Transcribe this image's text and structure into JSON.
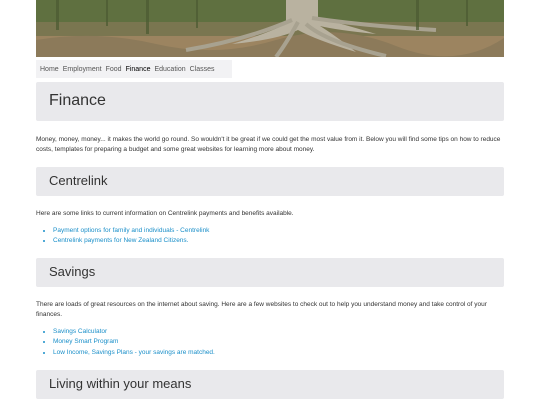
{
  "nav": {
    "items": [
      "Home",
      "Employment",
      "Food",
      "Finance",
      "Education",
      "Classes"
    ],
    "active": "Finance"
  },
  "finance": {
    "title": "Finance",
    "intro": "Money, money, money... it makes the world go round. So wouldn't it be great if we could get the most value from it. Below you will find some tips on how to reduce costs, templates for preparing a budget and some great websites for learning more about money."
  },
  "centrelink": {
    "title": "Centrelink",
    "intro": "Here are some links to current information on Centrelink payments and benefits available.",
    "links": [
      "Payment options for family and individuals - Centrelink",
      "Centrelink payments for New Zealand Citizens."
    ]
  },
  "savings": {
    "title": "Savings",
    "intro": "There are loads of great resources on the internet about saving. Here are a few websites to check out to help you understand money and take control of your finances.",
    "links": [
      "Savings Calculator",
      "Money Smart Program",
      "Low Income, Savings Plans - your savings are matched."
    ]
  },
  "living": {
    "title": "Living within your means"
  },
  "colors": {
    "link": "#1a8fc9",
    "banner_bg": "#e9e9ec"
  }
}
